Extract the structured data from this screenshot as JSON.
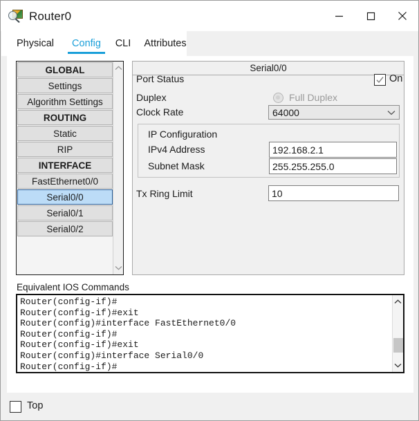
{
  "window": {
    "title": "Router0",
    "icon": "inspect-device-icon",
    "controls": [
      {
        "name": "minimize-button",
        "glyph": "minimize-icon"
      },
      {
        "name": "maximize-button",
        "glyph": "maximize-icon"
      },
      {
        "name": "close-button",
        "glyph": "close-icon"
      }
    ]
  },
  "tabs": [
    {
      "label": "Physical",
      "active": false
    },
    {
      "label": "Config",
      "active": true
    },
    {
      "label": "CLI",
      "active": false
    },
    {
      "label": "Attributes",
      "active": false
    }
  ],
  "sidebar": {
    "items": [
      {
        "label": "GLOBAL",
        "type": "header",
        "selected": false
      },
      {
        "label": "Settings",
        "type": "item",
        "selected": false
      },
      {
        "label": "Algorithm Settings",
        "type": "item",
        "selected": false
      },
      {
        "label": "ROUTING",
        "type": "header",
        "selected": false
      },
      {
        "label": "Static",
        "type": "item",
        "selected": false
      },
      {
        "label": "RIP",
        "type": "item",
        "selected": false
      },
      {
        "label": "INTERFACE",
        "type": "header",
        "selected": false
      },
      {
        "label": "FastEthernet0/0",
        "type": "item",
        "selected": false
      },
      {
        "label": "Serial0/0",
        "type": "item",
        "selected": true
      },
      {
        "label": "Serial0/1",
        "type": "item",
        "selected": false
      },
      {
        "label": "Serial0/2",
        "type": "item",
        "selected": false
      }
    ],
    "scroll_up_icon": "chevron-up-icon",
    "scroll_down_icon": "chevron-down-icon"
  },
  "config_panel": {
    "header": "Serial0/0",
    "port_status": {
      "label": "Port Status",
      "checkbox_checked": true,
      "state_label": "On"
    },
    "duplex": {
      "label": "Duplex",
      "option_label": "Full Duplex",
      "selected": true,
      "disabled": true
    },
    "clock_rate": {
      "label": "Clock Rate",
      "value": "64000",
      "chevron": "chevron-down-icon"
    },
    "ip_configuration": {
      "title": "IP Configuration",
      "ipv4_address": {
        "label": "IPv4 Address",
        "value": "192.168.2.1"
      },
      "subnet_mask": {
        "label": "Subnet Mask",
        "value": "255.255.255.0"
      }
    },
    "tx_ring_limit": {
      "label": "Tx Ring Limit",
      "value": "10"
    }
  },
  "ios_commands": {
    "label": "Equivalent IOS Commands",
    "lines": [
      "Router(config-if)#",
      "Router(config-if)#exit",
      "Router(config)#interface FastEthernet0/0",
      "Router(config-if)#",
      "Router(config-if)#exit",
      "Router(config)#interface Serial0/0",
      "Router(config-if)#"
    ]
  },
  "bottom": {
    "top_checkbox": {
      "label": "Top",
      "checked": false
    }
  },
  "colors": {
    "accent": "#1a9fd9",
    "selection": "#bcdcf7",
    "selection_border": "#2a5d96",
    "panel_bg": "#f0f0f0",
    "nav_item_bg": "#e0e0e0"
  }
}
